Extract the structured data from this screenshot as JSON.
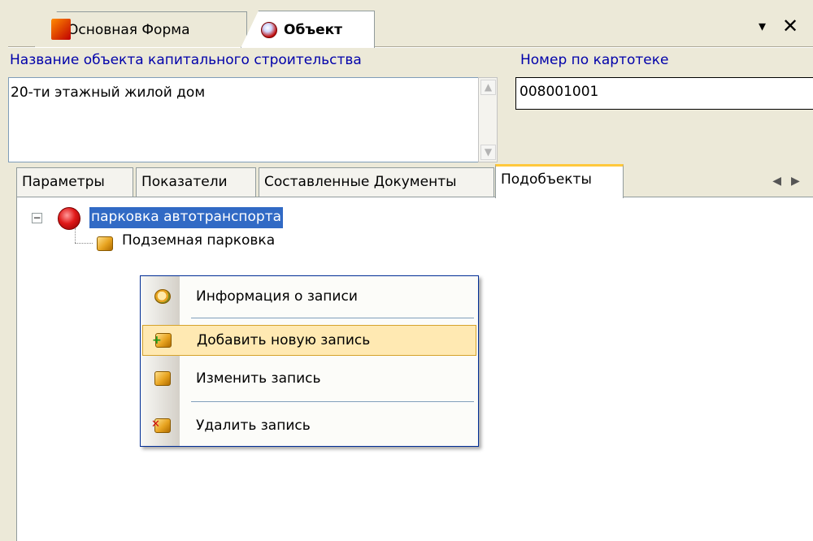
{
  "doc_tabs": [
    {
      "label": "Основная Форма",
      "active": false
    },
    {
      "label": "Объект",
      "active": true
    }
  ],
  "window": {
    "menu_glyph": "▾",
    "close_glyph": "✕"
  },
  "form": {
    "name_label": "Название объекта капитального строительства",
    "name_value": "20-ти этажный жилой дом",
    "card_label": "Номер по картотеке",
    "card_value": "008001001"
  },
  "inner_tabs": [
    {
      "label": "Параметры",
      "active": false
    },
    {
      "label": "Показатели",
      "active": false
    },
    {
      "label": "Составленные Документы",
      "active": false
    },
    {
      "label": "Подобъекты",
      "active": true
    }
  ],
  "tree": {
    "root": {
      "label": "парковка автотранспорта",
      "expanded": true,
      "selected": true
    },
    "children": [
      {
        "label": "Подземная парковка"
      }
    ]
  },
  "context_menu": {
    "items": [
      {
        "label": "Информация о записи"
      },
      {
        "label": "Добавить новую запись",
        "highlighted": true
      },
      {
        "label": "Изменить запись"
      },
      {
        "label": "Удалить запись"
      }
    ]
  },
  "colors": {
    "accent_link": "#0000aa",
    "selection": "#316ac5",
    "menu_highlight": "#ffe9b2",
    "active_tab_top": "#ffc83c"
  }
}
